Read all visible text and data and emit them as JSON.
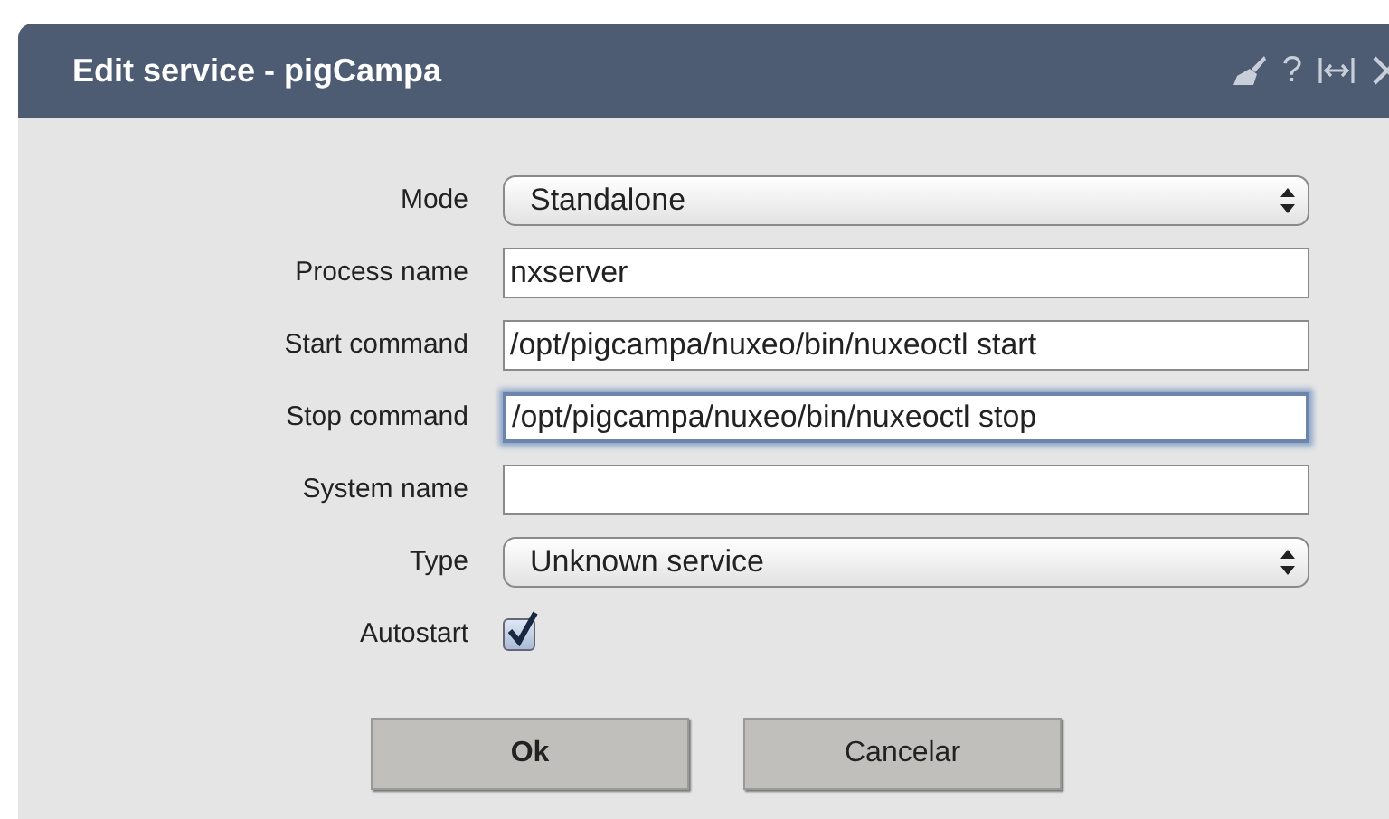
{
  "dialog": {
    "title": "Edit service - pigCampa",
    "header_icons": [
      "?"
    ]
  },
  "fields": [
    {
      "label": "Mode",
      "kind": "select",
      "value": "Standalone"
    },
    {
      "label": "Process name",
      "kind": "text",
      "value": "nxserver",
      "focused": false
    },
    {
      "label": "Start command",
      "kind": "text",
      "value": "/opt/pigcampa/nuxeo/bin/nuxeoctl start",
      "focused": false
    },
    {
      "label": "Stop command",
      "kind": "text",
      "value": "/opt/pigcampa/nuxeo/bin/nuxeoctl stop",
      "focused": true
    },
    {
      "label": "System name",
      "kind": "text",
      "focused": false
    },
    {
      "label": "Type",
      "kind": "select",
      "value": "Unknown service"
    },
    {
      "label": "Autostart",
      "kind": "checkbox",
      "checked": true
    }
  ],
  "buttons": [
    {
      "label": "Ok",
      "primary": true
    },
    {
      "label": "Cancelar",
      "primary": false
    }
  ]
}
